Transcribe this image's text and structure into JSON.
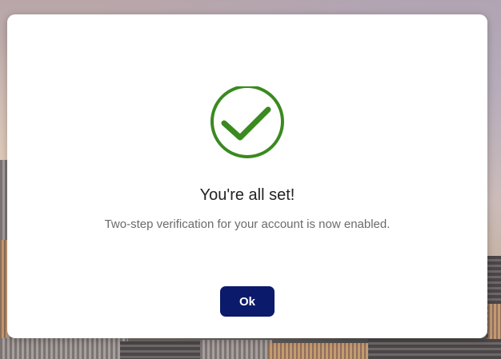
{
  "dialog": {
    "icon": "check-circle-icon",
    "title": "You're all set!",
    "message": "Two-step verification for your account is now enabled.",
    "ok_label": "Ok"
  },
  "colors": {
    "success": "#3a8a1f",
    "button": "#0c1a6b",
    "button_text": "#ffffff",
    "dialog_bg": "#ffffff"
  }
}
